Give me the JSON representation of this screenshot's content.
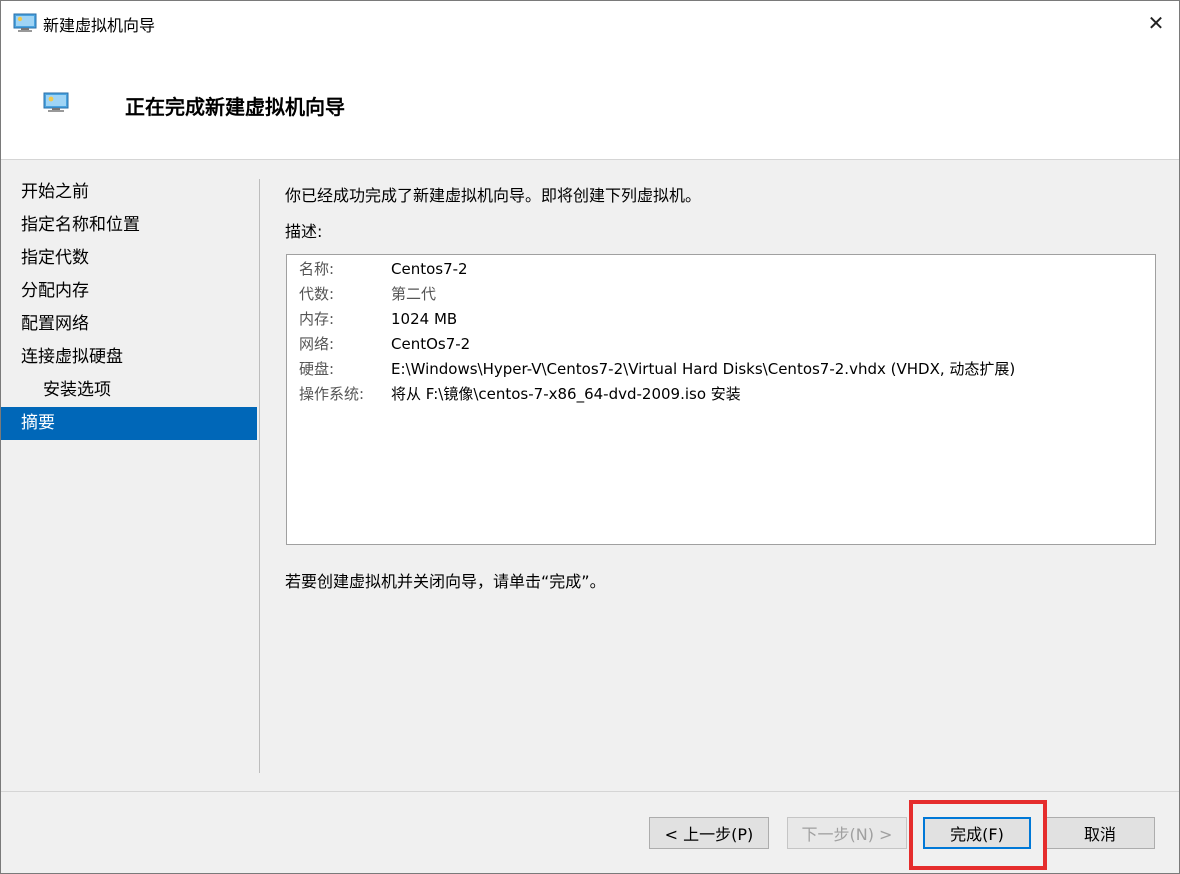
{
  "window": {
    "title": "新建虚拟机向导",
    "close_glyph": "✕"
  },
  "header": {
    "title": "正在完成新建虚拟机向导"
  },
  "sidebar": {
    "items": [
      {
        "label": "开始之前"
      },
      {
        "label": "指定名称和位置"
      },
      {
        "label": "指定代数"
      },
      {
        "label": "分配内存"
      },
      {
        "label": "配置网络"
      },
      {
        "label": "连接虚拟硬盘"
      },
      {
        "label": "安装选项"
      },
      {
        "label": "摘要"
      }
    ],
    "active_index": 7
  },
  "main": {
    "intro": "你已经成功完成了新建虚拟机向导。即将创建下列虚拟机。",
    "description_label": "描述:",
    "summary": [
      {
        "key": "名称:",
        "value": "Centos7-2"
      },
      {
        "key": "代数:",
        "value": "第二代"
      },
      {
        "key": "内存:",
        "value": "1024 MB"
      },
      {
        "key": "网络:",
        "value": "CentOs7-2"
      },
      {
        "key": "硬盘:",
        "value": "E:\\Windows\\Hyper-V\\Centos7-2\\Virtual Hard Disks\\Centos7-2.vhdx (VHDX, 动态扩展)"
      },
      {
        "key": "操作系统:",
        "value": "将从 F:\\镜像\\centos-7-x86_64-dvd-2009.iso 安装"
      }
    ],
    "footer_text": "若要创建虚拟机并关闭向导，请单击“完成”。"
  },
  "buttons": {
    "previous": "< 上一步(P)",
    "next": "下一步(N) >",
    "finish": "完成(F)",
    "cancel": "取消"
  },
  "colors": {
    "accent": "#0067b8",
    "highlight": "#e52d2d"
  },
  "icons": {
    "title": "hyper-v-vm-icon",
    "header": "hyper-v-vm-icon"
  }
}
